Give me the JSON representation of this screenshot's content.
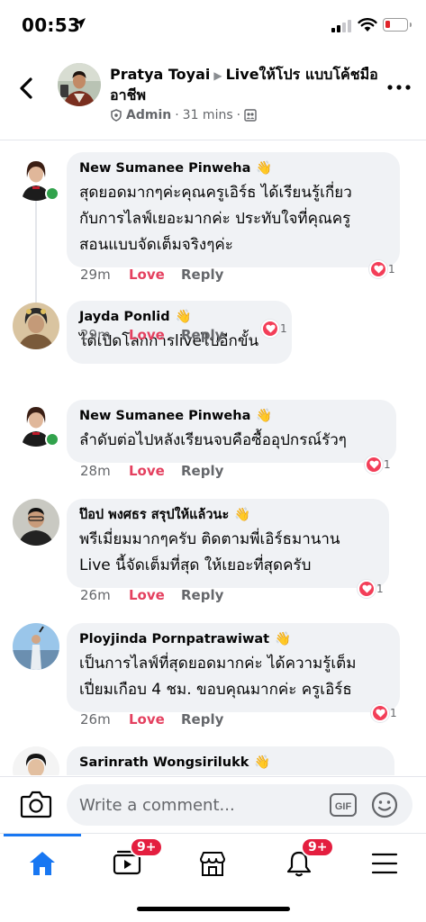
{
  "status_bar": {
    "time": "00:53"
  },
  "header": {
    "author": "Pratya Toyai",
    "group": "Liveให้โปร แบบโค้ชมืออาชีพ",
    "role": "Admin",
    "age": "31 mins",
    "separator": "·"
  },
  "comments": [
    {
      "name": "New Sumanee Pinweha",
      "text_lines": [
        "สุดยอดมากๆค่ะคุณครูเอิร์ธ ได้เรียนรู้เกี่ยว",
        "กับการไลฟ์เยอะมากค่ะ ประทับใจที่คุณครู",
        "สอนแบบจัดเต็มจริงๆค่ะ"
      ],
      "time": "29m",
      "love": "Love",
      "reply": "Reply",
      "reactions": "1"
    },
    {
      "name": "Jayda Ponlid",
      "text_lines": [
        "ได้เปิดโลกการliveไปอีกขั้น"
      ],
      "time": "29m",
      "love": "Love",
      "reply": "Reply",
      "reactions": "1"
    },
    {
      "name": "New Sumanee Pinweha",
      "text_lines": [
        "ลำดับต่อไปหลังเรียนจบคือซื้ออุปกรณ์รัวๆ"
      ],
      "time": "28m",
      "love": "Love",
      "reply": "Reply",
      "reactions": "1"
    },
    {
      "name": "ป๊อป พงศธร สรุปให้แล้วนะ",
      "text_lines": [
        "พรีเมี่ยมมากๆครับ ติดตามพี่เอิร์ธมานาน",
        "Live นี้จัดเต็มที่สุด ให้เยอะที่สุดครับ"
      ],
      "time": "26m",
      "love": "Love",
      "reply": "Reply",
      "reactions": "1"
    },
    {
      "name": "Ployjinda Pornpatrawiwat",
      "text_lines": [
        "เป็นการไลฟ์ที่สุดยอดมากค่ะ ได้ความรู้เต็ม",
        "เปี่ยมเกือบ 4 ชม. ขอบคุณมากค่ะ ครูเอิร์ธ"
      ],
      "time": "26m",
      "love": "Love",
      "reply": "Reply",
      "reactions": "1"
    },
    {
      "name": "Sarinrath Wongsirilukk",
      "text_lines": []
    }
  ],
  "composer": {
    "placeholder": "Write a comment...",
    "gif_label": "GIF"
  },
  "nav": {
    "watch_badge": "9+",
    "notifications_badge": "9+"
  },
  "colors": {
    "accent": "#1877f2",
    "love": "#e4405f",
    "badge": "#e41e3f",
    "online": "#31a24c"
  }
}
